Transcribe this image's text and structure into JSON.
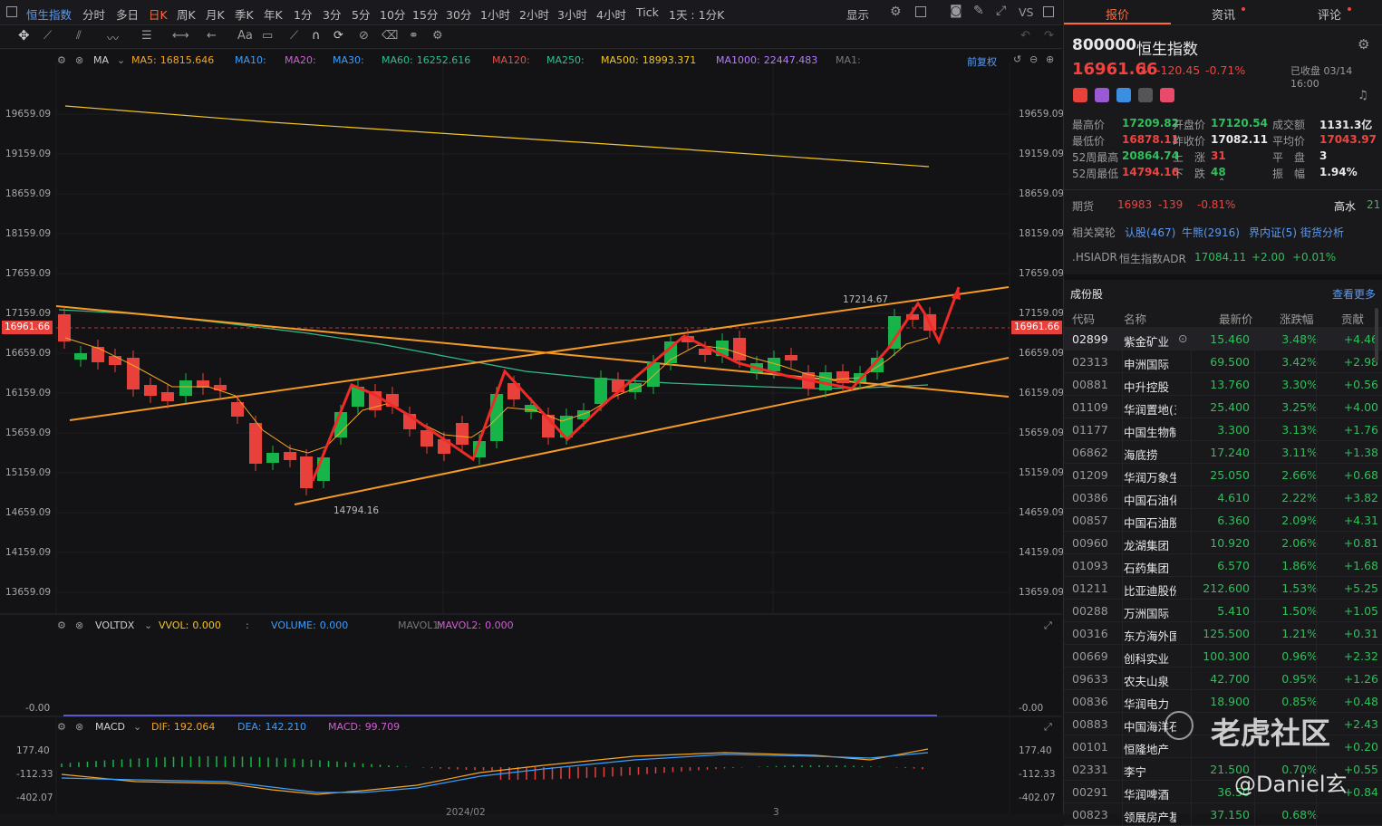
{
  "topbar": {
    "symbol": "恒生指数",
    "timeframes": [
      "分时",
      "多日",
      "日K",
      "周K",
      "月K",
      "季K",
      "年K",
      "1分",
      "3分",
      "5分",
      "10分",
      "15分",
      "30分",
      "1小时",
      "2小时",
      "3小时",
      "4小时",
      "Tick",
      "1天 : 1分K"
    ],
    "active_timeframe": "日K",
    "display_label": "显示",
    "vs_label": "VS"
  },
  "ma_legend": {
    "name": "MA",
    "items": [
      {
        "label": "MA5:",
        "value": "16815.646",
        "color": "#f5a623"
      },
      {
        "label": "MA10:",
        "value": "",
        "color": "#3aa0ff"
      },
      {
        "label": "MA20:",
        "value": "",
        "color": "#d45cd4"
      },
      {
        "label": "MA30:",
        "value": "",
        "color": "#3aa0ff"
      },
      {
        "label": "MA60:",
        "value": "16252.616",
        "color": "#2fbf8a"
      },
      {
        "label": "MA120:",
        "value": "",
        "color": "#e0524b"
      },
      {
        "label": "MA250:",
        "value": "",
        "color": "#2fbf8a"
      },
      {
        "label": "MA500:",
        "value": "18993.371",
        "color": "#f3c623"
      },
      {
        "label": "MA1000:",
        "value": "22447.483",
        "color": "#b57cff"
      },
      {
        "label": "MA1:",
        "value": "",
        "color": "#777777"
      }
    ],
    "restore_label": "前复权"
  },
  "price_axis": [
    "19659.09",
    "19159.09",
    "18659.09",
    "18159.09",
    "17659.09",
    "17159.09",
    "16659.09",
    "16159.09",
    "15659.09",
    "15159.09",
    "14659.09",
    "14159.09",
    "13659.09"
  ],
  "current_price_tag": "16961.66",
  "annotations": {
    "high_label": "17214.67",
    "low_label": "14794.16"
  },
  "volume_panel": {
    "name": "VOLTDX",
    "items": [
      {
        "label": "VVOL:",
        "value": "0.000",
        "color": "#f3c623"
      },
      {
        "label": ":",
        "value": "",
        "color": "#999999"
      },
      {
        "label": "VOLUME:",
        "value": "0.000",
        "color": "#3aa0ff"
      },
      {
        "label": "MAVOL1:",
        "value": "",
        "color": "#777777"
      },
      {
        "label": "MAVOL2:",
        "value": "0.000",
        "color": "#d45cd4"
      }
    ],
    "axis_value": "-0.00"
  },
  "macd_panel": {
    "name": "MACD",
    "items": [
      {
        "label": "DIF:",
        "value": "192.064",
        "color": "#f5a623"
      },
      {
        "label": "DEA:",
        "value": "142.210",
        "color": "#3aa0ff"
      },
      {
        "label": "MACD:",
        "value": "99.709",
        "color": "#d45cd4"
      }
    ],
    "axis": [
      "177.40",
      "-112.33",
      "-402.07"
    ]
  },
  "date_labels": [
    "2024/02",
    "3"
  ],
  "right_tabs": [
    "报价",
    "资讯",
    "评论"
  ],
  "quote": {
    "code": "800000",
    "name": "恒生指数",
    "price": "16961.66",
    "arrow": "↓",
    "change": "-120.45",
    "change_pct": "-0.71%",
    "status": "已收盘 03/14 16:00",
    "stats": [
      {
        "label": "最高价",
        "value": "17209.82",
        "cls": "green"
      },
      {
        "label": "开盘价",
        "value": "17120.54",
        "cls": "green"
      },
      {
        "label": "成交额",
        "value": "1131.3亿",
        "cls": "white"
      },
      {
        "label": "最低价",
        "value": "16878.11",
        "cls": "red"
      },
      {
        "label": "昨收价",
        "value": "17082.11",
        "cls": "white"
      },
      {
        "label": "平均价",
        "value": "17043.97",
        "cls": "red"
      },
      {
        "label": "52周最高",
        "value": "20864.74",
        "cls": "green"
      },
      {
        "label": "上　涨",
        "value": "31",
        "cls": "red"
      },
      {
        "label": "平　盘",
        "value": "3",
        "cls": "white"
      },
      {
        "label": "52周最低",
        "value": "14794.16",
        "cls": "red"
      },
      {
        "label": "下　跌",
        "value": "48",
        "cls": "green"
      },
      {
        "label": "振　幅",
        "value": "1.94%",
        "cls": "white"
      }
    ],
    "futures": {
      "label": "期货",
      "price": "16983",
      "change": "-139",
      "pct": "-0.81%",
      "tag": "高水",
      "tag_value": "21"
    },
    "related": {
      "label": "相关窝轮",
      "links": [
        "认股(467)",
        "牛熊(2916)",
        "界内证(5)",
        "街货分析"
      ]
    },
    "adr": {
      "code": ".HSIADR",
      "name": "恒生指数ADR",
      "price": "17084.11",
      "change": "+2.00",
      "pct": "+0.01%"
    }
  },
  "components": {
    "title": "成份股",
    "more": "查看更多",
    "headers": [
      "代码",
      "名称",
      "最新价",
      "涨跌幅",
      "贡献"
    ],
    "rows": [
      [
        "02899",
        "紫金矿业",
        "15.460",
        "3.48%",
        "+4.46"
      ],
      [
        "02313",
        "申洲国际",
        "69.500",
        "3.42%",
        "+2.98"
      ],
      [
        "00881",
        "中升控股",
        "13.760",
        "3.30%",
        "+0.56"
      ],
      [
        "01109",
        "华润置地(五",
        "25.400",
        "3.25%",
        "+4.00"
      ],
      [
        "01177",
        "中国生物制",
        "3.300",
        "3.13%",
        "+1.76"
      ],
      [
        "06862",
        "海底捞",
        "17.240",
        "3.11%",
        "+1.38"
      ],
      [
        "01209",
        "华润万象生",
        "25.050",
        "2.66%",
        "+0.68"
      ],
      [
        "00386",
        "中国石油化",
        "4.610",
        "2.22%",
        "+3.82"
      ],
      [
        "00857",
        "中国石油股",
        "6.360",
        "2.09%",
        "+4.31"
      ],
      [
        "00960",
        "龙湖集团",
        "10.920",
        "2.06%",
        "+0.81"
      ],
      [
        "01093",
        "石药集团",
        "6.570",
        "1.86%",
        "+1.68"
      ],
      [
        "01211",
        "比亚迪股份",
        "212.600",
        "1.53%",
        "+5.25"
      ],
      [
        "00288",
        "万洲国际",
        "5.410",
        "1.50%",
        "+1.05"
      ],
      [
        "00316",
        "东方海外国",
        "125.500",
        "1.21%",
        "+0.31"
      ],
      [
        "00669",
        "创科实业",
        "100.300",
        "0.96%",
        "+2.32"
      ],
      [
        "09633",
        "农夫山泉",
        "42.700",
        "0.95%",
        "+1.26"
      ],
      [
        "00836",
        "华润电力",
        "18.900",
        "0.85%",
        "+0.48"
      ],
      [
        "00883",
        "中国海洋石",
        "",
        "",
        "+2.43"
      ],
      [
        "00101",
        "恒隆地产",
        "",
        "",
        "+0.20"
      ],
      [
        "02331",
        "李宁",
        "21.500",
        "0.70%",
        "+0.55"
      ],
      [
        "00291",
        "华润啤酒",
        "36.50",
        "",
        "+0.84"
      ],
      [
        "00823",
        "领展房产基",
        "37.150",
        "0.68%",
        ""
      ]
    ]
  },
  "watermark": {
    "brand": "老虎社区",
    "user": "@Daniel玄"
  }
}
